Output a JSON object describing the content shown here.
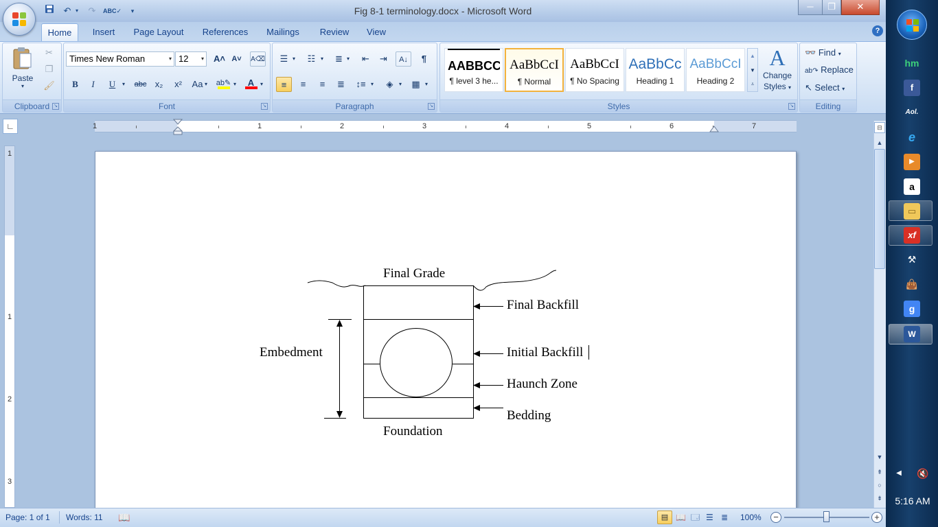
{
  "window": {
    "title": "Fig 8-1 terminology.docx - Microsoft Word",
    "minimize_label": "─",
    "restore_label": "❐",
    "close_label": "✕"
  },
  "tabs": [
    {
      "label": "Home",
      "active": true
    },
    {
      "label": "Insert"
    },
    {
      "label": "Page Layout"
    },
    {
      "label": "References"
    },
    {
      "label": "Mailings"
    },
    {
      "label": "Review"
    },
    {
      "label": "View"
    }
  ],
  "clipboard": {
    "group_label": "Clipboard",
    "paste_label": "Paste"
  },
  "font": {
    "group_label": "Font",
    "font_name": "Times New Roman",
    "font_size": "12",
    "bold": "B",
    "italic": "I",
    "underline": "U",
    "strike": "abc",
    "sub": "x₂",
    "sup": "x²",
    "change_case": "Aa",
    "grow": "A˄",
    "shrink": "A˅",
    "font_color": "A"
  },
  "paragraph": {
    "group_label": "Paragraph"
  },
  "styles": {
    "group_label": "Styles",
    "items": [
      {
        "sample": "AABBCC",
        "name": "¶ level 3 he..."
      },
      {
        "sample": "AaBbCcI",
        "name": "¶ Normal",
        "selected": true
      },
      {
        "sample": "AaBbCcI",
        "name": "¶ No Spacing"
      },
      {
        "sample": "AaBbCc",
        "name": "Heading 1"
      },
      {
        "sample": "AaBbCcI",
        "name": "Heading 2"
      }
    ],
    "change_styles_line1": "Change",
    "change_styles_line2": "Styles"
  },
  "editing": {
    "group_label": "Editing",
    "find_label": "Find",
    "replace_label": "Replace",
    "select_label": "Select"
  },
  "ruler": {
    "numbers": [
      "1",
      "1",
      "2",
      "3",
      "4",
      "5",
      "6",
      "7"
    ],
    "vnumbers": [
      "1",
      "1",
      "2",
      "3"
    ]
  },
  "figure": {
    "final_grade": "Final Grade",
    "final_backfill": "Final Backfill",
    "embedment": "Embedment",
    "initial_backfill": "Initial Backfill",
    "haunch_zone": "Haunch Zone",
    "bedding": "Bedding",
    "foundation": "Foundation"
  },
  "status": {
    "page": "Page: 1 of 1",
    "words": "Words: 11",
    "zoom": "100%"
  },
  "taskbar": {
    "clock": "5:16 AM"
  },
  "colors": {
    "ribbon_text": "#15428b",
    "accent_blue": "#15428b",
    "highlight_yellow": "#ffff00",
    "font_color_red": "#ff0000",
    "taskbar_bg": "#17406c"
  }
}
